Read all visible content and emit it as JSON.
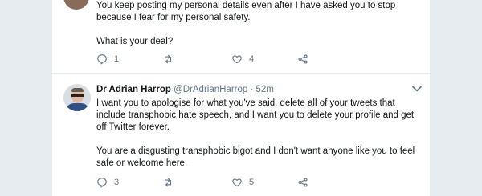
{
  "tweets": [
    {
      "paragraphs": [
        "You keep posting my personal details even after I have asked you to stop because I fear for my personal safety.",
        "What is your deal?"
      ],
      "reply_count": "1",
      "retweet_count": "",
      "like_count": "4"
    },
    {
      "name": "Dr Adrian Harrop",
      "handle": "@DrAdrianHarrop",
      "separator": "·",
      "time": "52m",
      "paragraphs": [
        "I want you to apologise for what you've said, delete all of your tweets that include transphobic hate speech, and I want you to delete your profile and get off Twitter forever.",
        "You are a disgusting transphobic bigot and I don't want anyone like you to feel safe or welcome here."
      ],
      "reply_count": "3",
      "retweet_count": "",
      "like_count": "5"
    }
  ],
  "icons": {
    "reply": "reply-icon",
    "retweet": "retweet-icon",
    "like": "heart-icon",
    "share": "share-icon",
    "menu": "chevron-down-icon"
  },
  "colors": {
    "background": "#e6ecf0",
    "card": "#ffffff",
    "text": "#14171a",
    "muted": "#657786"
  }
}
